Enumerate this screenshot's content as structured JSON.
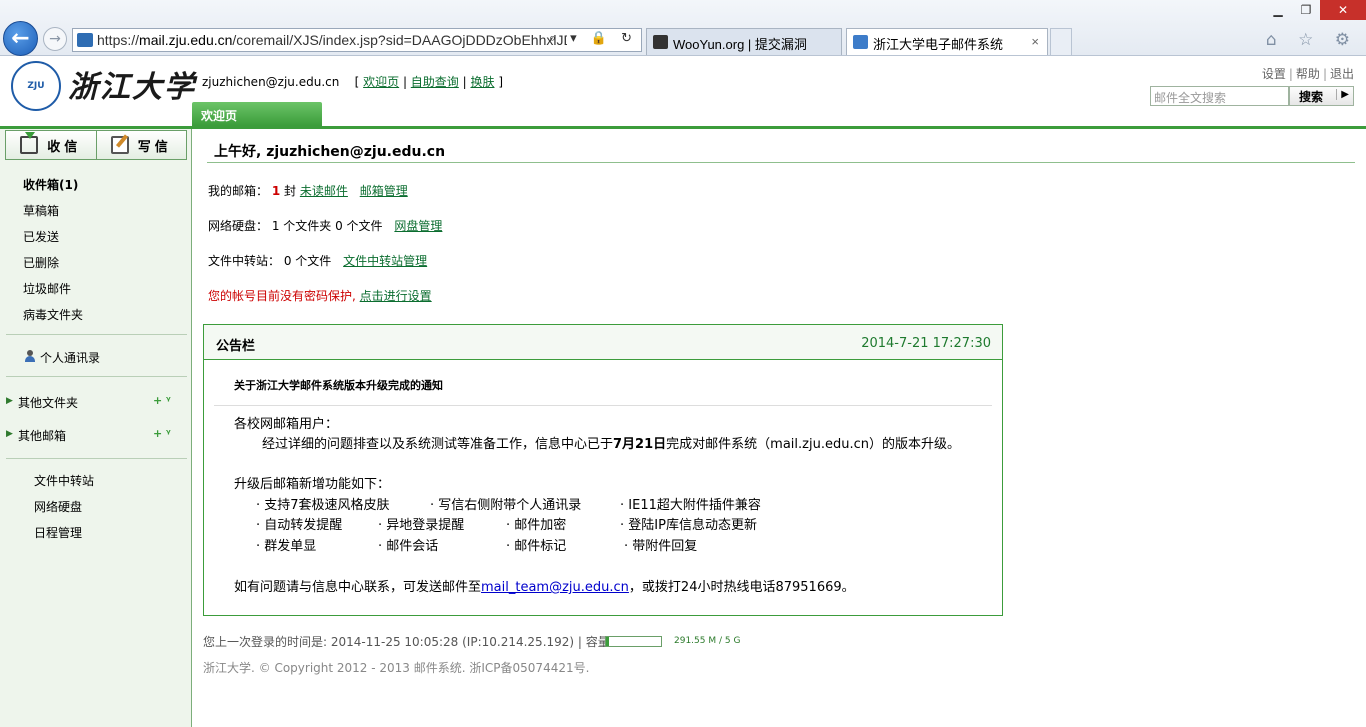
{
  "browser": {
    "url_prefix": "https://",
    "url_host": "mail.zju.edu.cn",
    "url_rest": "/coremail/XJS/index.jsp?sid=DAAGOjDDDzObEhhxlJDDacir",
    "addr_controls": "⌕ ▾ 🔒 ↻",
    "tabs": [
      {
        "label": "WooYun.org | 提交漏洞"
      },
      {
        "label": "浙江大学电子邮件系统"
      }
    ],
    "tab_close": "×",
    "window_controls": {
      "minimize": "▁",
      "restore": "❐",
      "close": "✕"
    },
    "tool_icons": "⌂ ☆ ⚙"
  },
  "header": {
    "logo_text": "浙江大学",
    "emblem_text": "ZJU",
    "user_email": "zjuzhichen@zju.edu.cn",
    "links": [
      "欢迎页",
      "自助查询",
      "换肤"
    ],
    "top_links": [
      "设置",
      "帮助",
      "退出"
    ],
    "search_placeholder": "邮件全文搜索",
    "search_button": "搜索",
    "active_tab": "欢迎页"
  },
  "sidebar": {
    "receive": "收信",
    "compose": "写信",
    "folders": [
      "收件箱(1)",
      "草稿箱",
      "已发送",
      "已删除",
      "垃圾邮件",
      "病毒文件夹"
    ],
    "contacts": "个人通讯录",
    "other_folders": "其他文件夹",
    "other_mailboxes": "其他邮箱",
    "ops": "+ ᵞ",
    "tools": [
      "文件中转站",
      "网络硬盘",
      "日程管理"
    ]
  },
  "main": {
    "greeting": "上午好, zjuzhichen@zju.edu.cn",
    "mailbox": {
      "label": "我的邮箱：",
      "count": "1",
      "unit": "封",
      "unread_link": "未读邮件",
      "manage_link": "邮箱管理"
    },
    "netdisk": {
      "label": "网络硬盘：",
      "text": "1 个文件夹 0 个文件",
      "link": "网盘管理"
    },
    "transfer": {
      "label": "文件中转站：",
      "text": "0 个文件",
      "link": "文件中转站管理"
    },
    "security": {
      "warning": "您的帐号目前没有密码保护,",
      "link": "点击进行设置"
    },
    "notice": {
      "title": "公告栏",
      "time": "2014-7-21 17:27:30",
      "subject": "关于浙江大学邮件系统版本升级完成的通知",
      "greeting_line": "各校网邮箱用户：",
      "body_pre": "经过详细的问题排查以及系统测试等准备工作，信息中心已于",
      "body_date": "7月21日",
      "body_post": "完成对邮件系统（mail.zju.edu.cn）的版本升级。",
      "features_title": "升级后邮箱新增功能如下：",
      "features": [
        "· 支持7套极速风格皮肤",
        "· 写信右侧附带个人通讯录",
        "· IE11超大附件插件兼容",
        "· 自动转发提醒",
        "· 异地登录提醒",
        "· 邮件加密",
        "· 登陆IP库信息动态更新",
        "· 群发单显",
        "· 邮件会话",
        "· 邮件标记",
        "· 带附件回复"
      ],
      "contact_pre": "如有问题请与信息中心联系，可发送邮件至",
      "contact_email": "mail_team@zju.edu.cn",
      "contact_post": "，或拨打24小时热线电话87951669。"
    },
    "last_login": "您上一次登录的时间是: 2014-11-25 10:05:28 (IP:10.214.25.192)  |  容量:",
    "quota_used_fraction": 0.057,
    "quota_text": "291.55 M / 5 G",
    "copyright": "浙江大学. © Copyright 2012 - 2013 邮件系统. 浙ICP备05074421号."
  },
  "colors": {
    "accent_green": "#3c9c3b",
    "link_green": "#0b6d2f",
    "warning_red": "#cc0000"
  }
}
